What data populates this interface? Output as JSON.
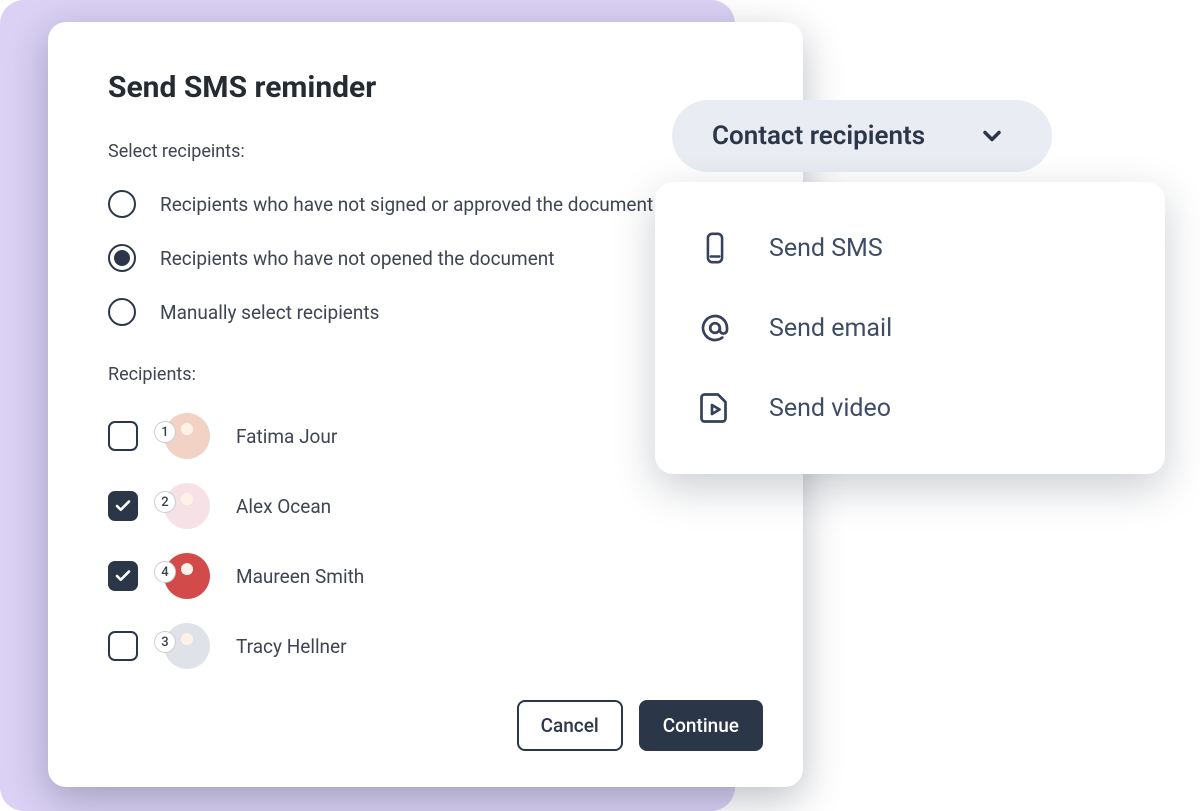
{
  "modal": {
    "title": "Send SMS reminder",
    "select_label": "Select recipeints:",
    "radios": [
      {
        "label": "Recipients who have not signed or approved the document",
        "selected": false
      },
      {
        "label": "Recipients who have not opened the document",
        "selected": true
      },
      {
        "label": "Manually select recipients",
        "selected": false
      }
    ],
    "recipients_label": "Recipients:",
    "recipients": [
      {
        "order": "1",
        "name": "Fatima Jour",
        "checked": false,
        "avatar_bg": "#f2d2c4"
      },
      {
        "order": "2",
        "name": "Alex Ocean",
        "checked": true,
        "avatar_bg": "#f5e1e6"
      },
      {
        "order": "4",
        "name": "Maureen Smith",
        "checked": true,
        "avatar_bg": "#d34a4a"
      },
      {
        "order": "3",
        "name": "Tracy Hellner",
        "checked": false,
        "avatar_bg": "#dfe2e8"
      }
    ],
    "cancel_label": "Cancel",
    "continue_label": "Continue"
  },
  "dropdown": {
    "label": "Contact recipients",
    "items": [
      {
        "icon": "phone-icon",
        "label": "Send SMS"
      },
      {
        "icon": "at-icon",
        "label": "Send email"
      },
      {
        "icon": "video-icon",
        "label": "Send video"
      }
    ]
  }
}
